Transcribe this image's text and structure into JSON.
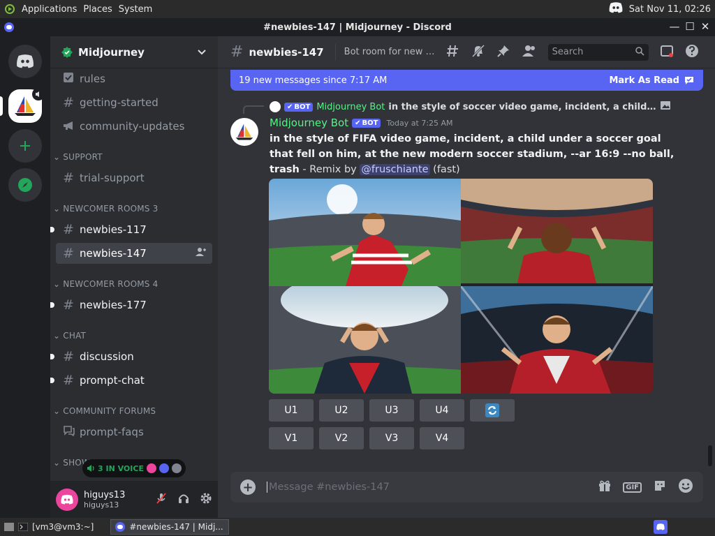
{
  "desktop": {
    "menu": [
      "Applications",
      "Places",
      "System"
    ],
    "clock": "Sat Nov 11, 02:26"
  },
  "window": {
    "title": "#newbies-147 | Midjourney - Discord",
    "controls": [
      "—",
      "☐",
      "✕"
    ]
  },
  "server": {
    "name": "Midjourney"
  },
  "channels": {
    "items": [
      {
        "label": "rules",
        "icon": "rules-icon"
      },
      {
        "label": "getting-started",
        "icon": "hash-icon"
      },
      {
        "label": "community-updates",
        "icon": "megaphone-icon"
      }
    ],
    "support_category": "SUPPORT",
    "support_items": [
      {
        "label": "trial-support"
      }
    ],
    "newcomer3_category": "NEWCOMER ROOMS 3",
    "newcomer3_items": [
      {
        "label": "newbies-117"
      },
      {
        "label": "newbies-147"
      }
    ],
    "newcomer4_category": "NEWCOMER ROOMS 4",
    "newcomer4_items": [
      {
        "label": "newbies-177"
      }
    ],
    "chat_category": "CHAT",
    "chat_items": [
      {
        "label": "discussion"
      },
      {
        "label": "prompt-chat"
      }
    ],
    "forums_category": "COMMUNITY FORUMS",
    "forums_items": [
      {
        "label": "prompt-faqs"
      }
    ],
    "show_category": "SHOW"
  },
  "voice": {
    "label": "3 IN VOICE"
  },
  "user": {
    "name": "higuys13",
    "tag": "higuys13"
  },
  "header": {
    "channel": "newbies-147",
    "topic": "Bot room for new us...",
    "search_placeholder": "Search"
  },
  "new_messages": {
    "text": "19 new messages since 7:17 AM",
    "mark_label": "Mark As Read"
  },
  "reply": {
    "bot_tag": "BOT",
    "author": "Midjourney Bot",
    "text": "in the style of soccer video game, incident, a child under a soccer goal that fell on him"
  },
  "message": {
    "author": "Midjourney Bot",
    "bot_tag": "BOT",
    "timestamp": "Today at 7:25 AM",
    "prompt": "in the style of FIFA video game, incident, a child under a soccer goal that fell on him, at the new modern soccer stadium, --ar 16:9 --no ball, trash",
    "suffix": " - Remix by ",
    "mention": "@fruschiante",
    "mode": " (fast)"
  },
  "buttons": {
    "row1": [
      "U1",
      "U2",
      "U3",
      "U4"
    ],
    "row2": [
      "V1",
      "V2",
      "V3",
      "V4"
    ],
    "reroll": "🔄"
  },
  "composer": {
    "placeholder": "Message #newbies-147",
    "gif_label": "GIF"
  },
  "taskbar": {
    "terminal": "[vm3@vm3:~]",
    "discord": "#newbies-147 | Midj..."
  },
  "colors": {
    "accent": "#5865f2",
    "bot_green": "#57f287",
    "online": "#23a55a"
  }
}
